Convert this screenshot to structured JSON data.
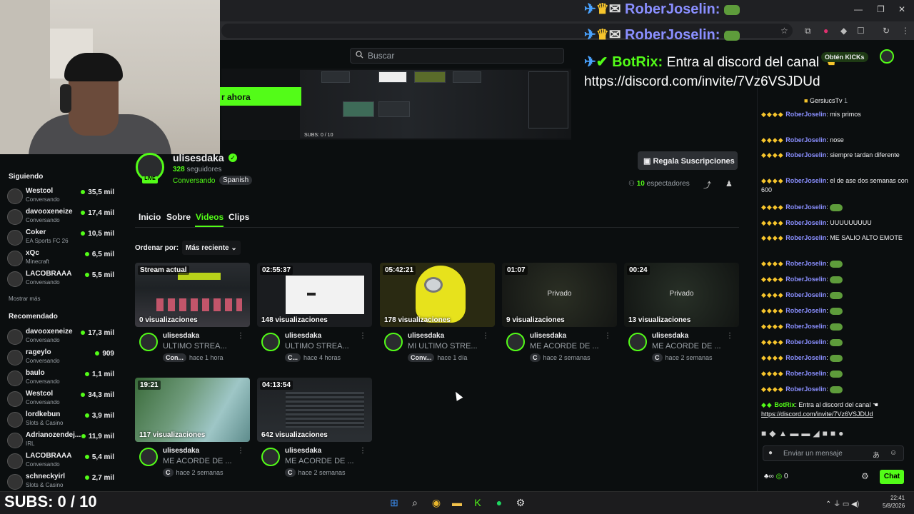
{
  "browser": {
    "controls": [
      "—",
      "❐",
      "✕"
    ],
    "toolbar_icons": [
      "☆",
      "⧉",
      "●",
      "◆",
      "☐",
      "↻",
      "⋮"
    ]
  },
  "kick": {
    "search_placeholder": "Buscar",
    "cta_button": "r ahora",
    "banner_subs": "SUBS: 0 / 10",
    "header_get_kicks": "Obtén KICKs"
  },
  "sidebar": {
    "following_title": "Siguiendo",
    "following": [
      {
        "name": "Westcol",
        "category": "Conversando",
        "viewers": "35,5 mil"
      },
      {
        "name": "davooxeneize",
        "category": "Conversando",
        "viewers": "17,4 mil"
      },
      {
        "name": "Coker",
        "category": "EA Sports FC 26",
        "viewers": "10,5 mil"
      },
      {
        "name": "xQc",
        "category": "Minecraft",
        "viewers": "6,5 mil"
      },
      {
        "name": "LACOBRAAA",
        "category": "Conversando",
        "viewers": "5,5 mil"
      }
    ],
    "show_more": "Mostrar más",
    "recommended_title": "Recomendado",
    "recommended": [
      {
        "name": "davooxeneize",
        "category": "Conversando",
        "viewers": "17,3 mil"
      },
      {
        "name": "rageylo",
        "category": "Conversando",
        "viewers": "909"
      },
      {
        "name": "baulo",
        "category": "Conversando",
        "viewers": "1,1 mil"
      },
      {
        "name": "Westcol",
        "category": "Conversando",
        "viewers": "34,3 mil"
      },
      {
        "name": "lordkebun",
        "category": "Slots & Casino",
        "viewers": "3,9 mil"
      },
      {
        "name": "Adrianozendej...",
        "category": "IRL",
        "viewers": "11,9 mil"
      },
      {
        "name": "LACOBRAAA",
        "category": "Conversando",
        "viewers": "5,4 mil"
      },
      {
        "name": "schneckyirl",
        "category": "Slots & Casino",
        "viewers": "2,7 mil"
      }
    ]
  },
  "channel": {
    "name": "ulisesdaka",
    "live_badge": "LIVE",
    "followers_count": "328",
    "followers_label": "seguidores",
    "category": "Conversando",
    "language": "Spanish",
    "gift_button": "Regala Suscripciones",
    "viewers_count": "10",
    "viewers_label": "espectadores",
    "tabs": [
      "Inicio",
      "Sobre",
      "Videos",
      "Clips"
    ],
    "sort_label": "Ordenar por:",
    "sort_value": "Más reciente ⌄"
  },
  "videos": [
    {
      "badge": "Stream actual",
      "views": "0 visualizaciones",
      "owner": "ulisesdaka",
      "title": "ULTIMO STREA...",
      "tag": "Con...",
      "time": "hace 1 hora",
      "private": ""
    },
    {
      "badge": "02:55:37",
      "views": "148 visualizaciones",
      "owner": "ulisesdaka",
      "title": "ULTIMO STREA...",
      "tag": "C...",
      "time": "hace 4 horas",
      "private": ""
    },
    {
      "badge": "05:42:21",
      "views": "178 visualizaciones",
      "owner": "ulisesdaka",
      "title": "MI ULTIMO STRE...",
      "tag": "Conv...",
      "time": "hace 1 día",
      "private": ""
    },
    {
      "badge": "01:07",
      "views": "9 visualizaciones",
      "owner": "ulisesdaka",
      "title": "ME ACORDE DE ...",
      "tag": "C",
      "time": "hace 2 semanas",
      "private": "Privado"
    },
    {
      "badge": "00:24",
      "views": "13 visualizaciones",
      "owner": "ulisesdaka",
      "title": "ME ACORDE DE ...",
      "tag": "C",
      "time": "hace 2 semanas",
      "private": "Privado"
    },
    {
      "badge": "19:21",
      "views": "117 visualizaciones",
      "owner": "ulisesdaka",
      "title": "ME ACORDE DE ...",
      "tag": "C",
      "time": "hace 2 semanas",
      "private": ""
    },
    {
      "badge": "04:13:54",
      "views": "642 visualizaciones",
      "owner": "ulisesdaka",
      "title": "ME ACORDE DE ...",
      "tag": "C",
      "time": "hace 2 semanas",
      "private": ""
    }
  ],
  "chat": {
    "pinned_user": "GersiucsTv",
    "pinned_count": "1",
    "messages": [
      {
        "user": "RoberJoselin",
        "text": "mis primos"
      },
      {
        "user": "RoberJoselin",
        "text": "nose"
      },
      {
        "user": "RoberJoselin",
        "text": "siempre tardan diferente"
      },
      {
        "user": "RoberJoselin",
        "text": "el de ase dos semanas con 600"
      },
      {
        "user": "RoberJoselin",
        "text": ""
      },
      {
        "user": "RoberJoselin",
        "text": "UUUUUUUUU"
      },
      {
        "user": "RoberJoselin",
        "text": "ME SALIO ALTO EMOTE"
      },
      {
        "user": "RoberJoselin",
        "text": ""
      },
      {
        "user": "RoberJoselin",
        "text": ""
      },
      {
        "user": "RoberJoselin",
        "text": ""
      },
      {
        "user": "RoberJoselin",
        "text": ""
      },
      {
        "user": "RoberJoselin",
        "text": ""
      },
      {
        "user": "RoberJoselin",
        "text": ""
      },
      {
        "user": "RoberJoselin",
        "text": ""
      },
      {
        "user": "RoberJoselin",
        "text": ""
      },
      {
        "user": "RoberJoselin",
        "text": ""
      }
    ],
    "bot_user": "BotRix",
    "bot_text": "Entra al discord del canal",
    "bot_link": "https://discord.com/invite/7Vz6VSJDUd",
    "input_placeholder": "Enviar un mensaje",
    "send_button": "Chat",
    "points": "0"
  },
  "overlay": {
    "line1_user": "RoberJoselin:",
    "line2_user": "RoberJoselin:",
    "bot_user": "BotRix:",
    "bot_text": "Entra al discord del canal",
    "bot_link": "https://discord.com/invite/7Vz6VSJDUd"
  },
  "stream": {
    "subs_counter": "SUBS: 0 / 10"
  },
  "taskbar": {
    "time": "22:41",
    "date": "5/8/2026"
  }
}
